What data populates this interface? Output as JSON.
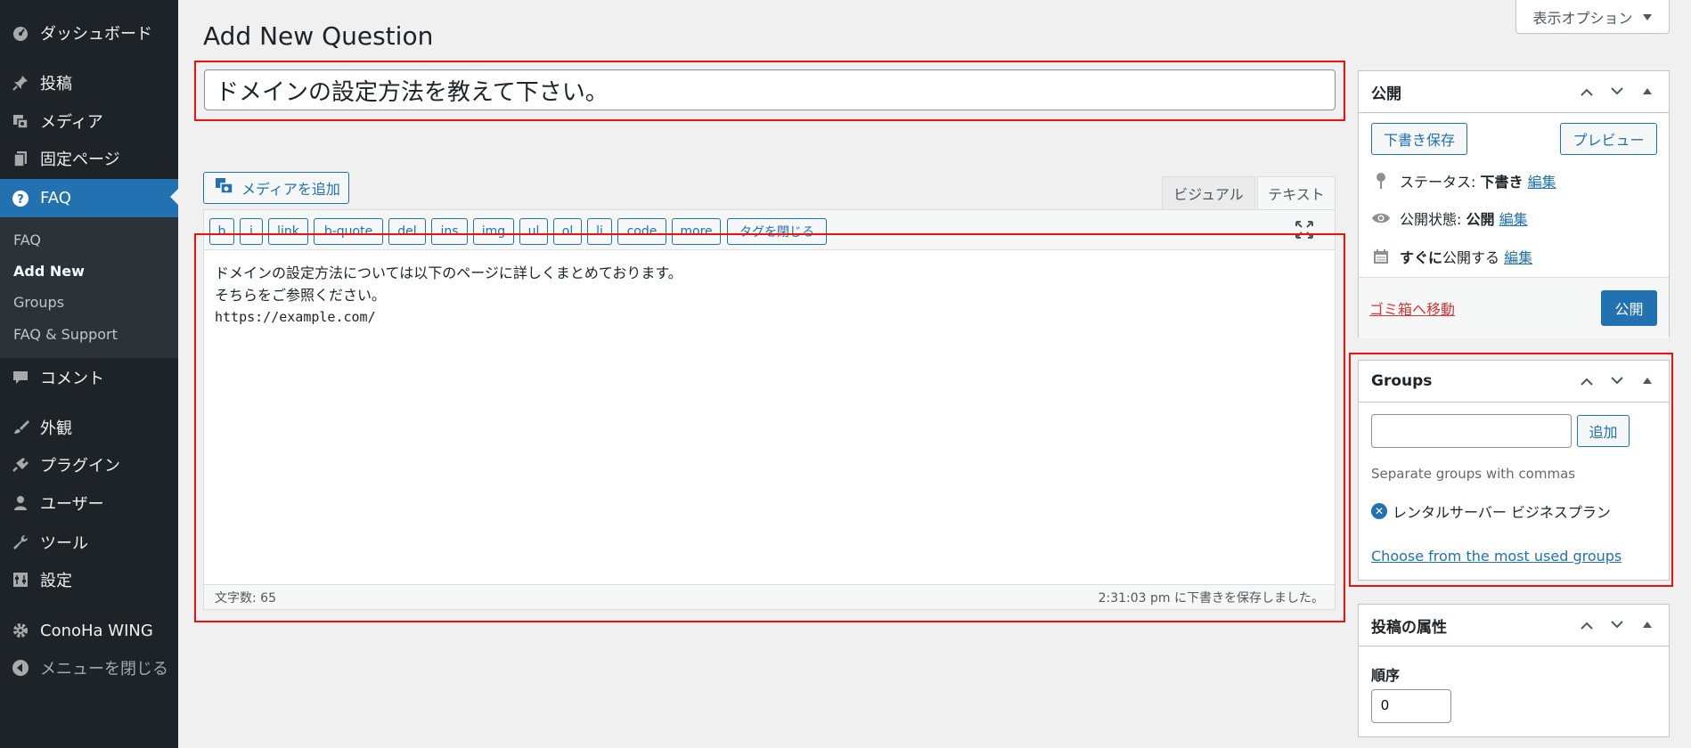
{
  "screen_options": {
    "label": "表示オプション"
  },
  "page": {
    "title": "Add New Question"
  },
  "sidebar": {
    "items": [
      {
        "label": "ダッシュボード"
      },
      {
        "label": "投稿"
      },
      {
        "label": "メディア"
      },
      {
        "label": "固定ページ"
      },
      {
        "label": "FAQ"
      },
      {
        "label": "コメント"
      },
      {
        "label": "外観"
      },
      {
        "label": "プラグイン"
      },
      {
        "label": "ユーザー"
      },
      {
        "label": "ツール"
      },
      {
        "label": "設定"
      },
      {
        "label": "ConoHa WING"
      },
      {
        "label": "メニューを閉じる"
      }
    ],
    "submenu": [
      {
        "label": "FAQ"
      },
      {
        "label": "Add New"
      },
      {
        "label": "Groups"
      },
      {
        "label": "FAQ & Support"
      }
    ]
  },
  "post": {
    "title_value": "ドメインの設定方法を教えて下さい。"
  },
  "editor": {
    "add_media": "メディアを追加",
    "tab_visual": "ビジュアル",
    "tab_text": "テキスト",
    "quicktags": [
      "b",
      "i",
      "link",
      "b-quote",
      "del",
      "ins",
      "img",
      "ul",
      "ol",
      "li",
      "code",
      "more",
      "タグを閉じる"
    ],
    "content_line1": "ドメインの設定方法については以下のページに詳しくまとめております。",
    "content_line2": "そちらをご参照ください。",
    "content_line3": "https://example.com/",
    "word_count": "文字数: 65",
    "save_status": "2:31:03 pm に下書きを保存しました。"
  },
  "publish": {
    "title": "公開",
    "save_draft": "下書き保存",
    "preview": "プレビュー",
    "status_label": "ステータス:",
    "status_value": "下書き",
    "visibility_label": "公開状態:",
    "visibility_value": "公開",
    "schedule_bold": "すぐに",
    "schedule_text": "公開する",
    "edit": "編集",
    "trash": "ゴミ箱へ移動",
    "publish_button": "公開"
  },
  "groups": {
    "title": "Groups",
    "add_button": "追加",
    "input_value": "",
    "hint": "Separate groups with commas",
    "tag": "レンタルサーバー ビジネスプラン",
    "choose_link": "Choose from the most used groups"
  },
  "attributes": {
    "title": "投稿の属性",
    "order_label": "順序",
    "order_value": "0"
  }
}
